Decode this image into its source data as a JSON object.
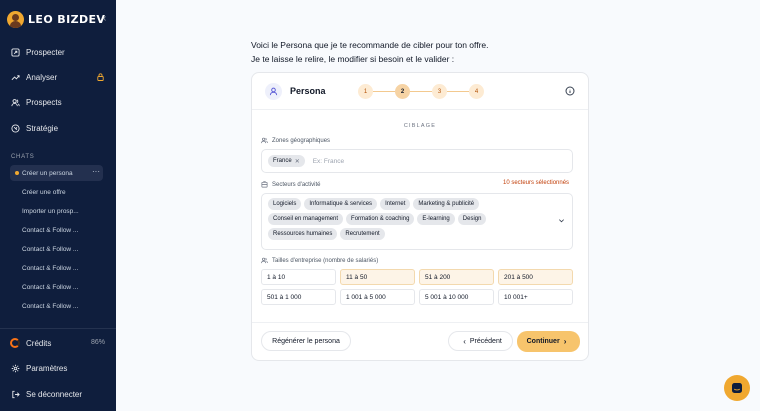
{
  "sidebar": {
    "brand": "LEO BIZDEV",
    "nav": [
      {
        "label": "Prospecter",
        "icon": "send-icon"
      },
      {
        "label": "Analyser",
        "icon": "trend-icon",
        "locked": true
      },
      {
        "label": "Prospects",
        "icon": "users-icon"
      },
      {
        "label": "Stratégie",
        "icon": "target-icon"
      }
    ],
    "chats_label": "CHATS",
    "chats": [
      "Créer un persona",
      "Créer une offre",
      "Importer un prosp...",
      "Contact & Follow ...",
      "Contact & Follow ...",
      "Contact & Follow ...",
      "Contact & Follow ...",
      "Contact & Follow ..."
    ],
    "credits_label": "Crédits",
    "credits_pct": "86%",
    "settings_label": "Paramètres",
    "logout_label": "Se déconnecter"
  },
  "main": {
    "intro_line1": "Voici le Persona que je te recommande de cibler pour ton offre.",
    "intro_line2": "Je te laisse le relire, le modifier si besoin et le valider :",
    "card": {
      "title": "Persona",
      "steps": [
        "1",
        "2",
        "3",
        "4"
      ],
      "active_step": 2,
      "section": "CIBLAGE",
      "zones_label": "Zones géographiques",
      "zones": [
        "France"
      ],
      "zones_placeholder": "Ex: France",
      "sectors_label": "Secteurs d'activité",
      "sectors_count": "10 secteurs sélectionnés",
      "sectors": [
        "Logiciels",
        "Informatique & services",
        "Internet",
        "Marketing & publicité",
        "Conseil en management",
        "Formation & coaching",
        "E-learning",
        "Design",
        "Ressources humaines",
        "Recrutement"
      ],
      "sizes_label": "Tailles d'entreprise (nombre de salariés)",
      "sizes": [
        {
          "label": "1 à 10",
          "selected": false
        },
        {
          "label": "11 à 50",
          "selected": true
        },
        {
          "label": "51 à 200",
          "selected": true
        },
        {
          "label": "201 à 500",
          "selected": true
        },
        {
          "label": "501 à 1 000",
          "selected": false
        },
        {
          "label": "1 001 à 5 000",
          "selected": false
        },
        {
          "label": "5 001 à 10 000",
          "selected": false
        },
        {
          "label": "10 001+",
          "selected": false
        }
      ],
      "regen_label": "Régénérer le persona",
      "prev_label": "Précédent",
      "next_label": "Continuer"
    }
  },
  "colors": {
    "accent": "#f7c46c",
    "sidebar_bg": "#0f1e3d",
    "warning_text": "#c2410c"
  }
}
